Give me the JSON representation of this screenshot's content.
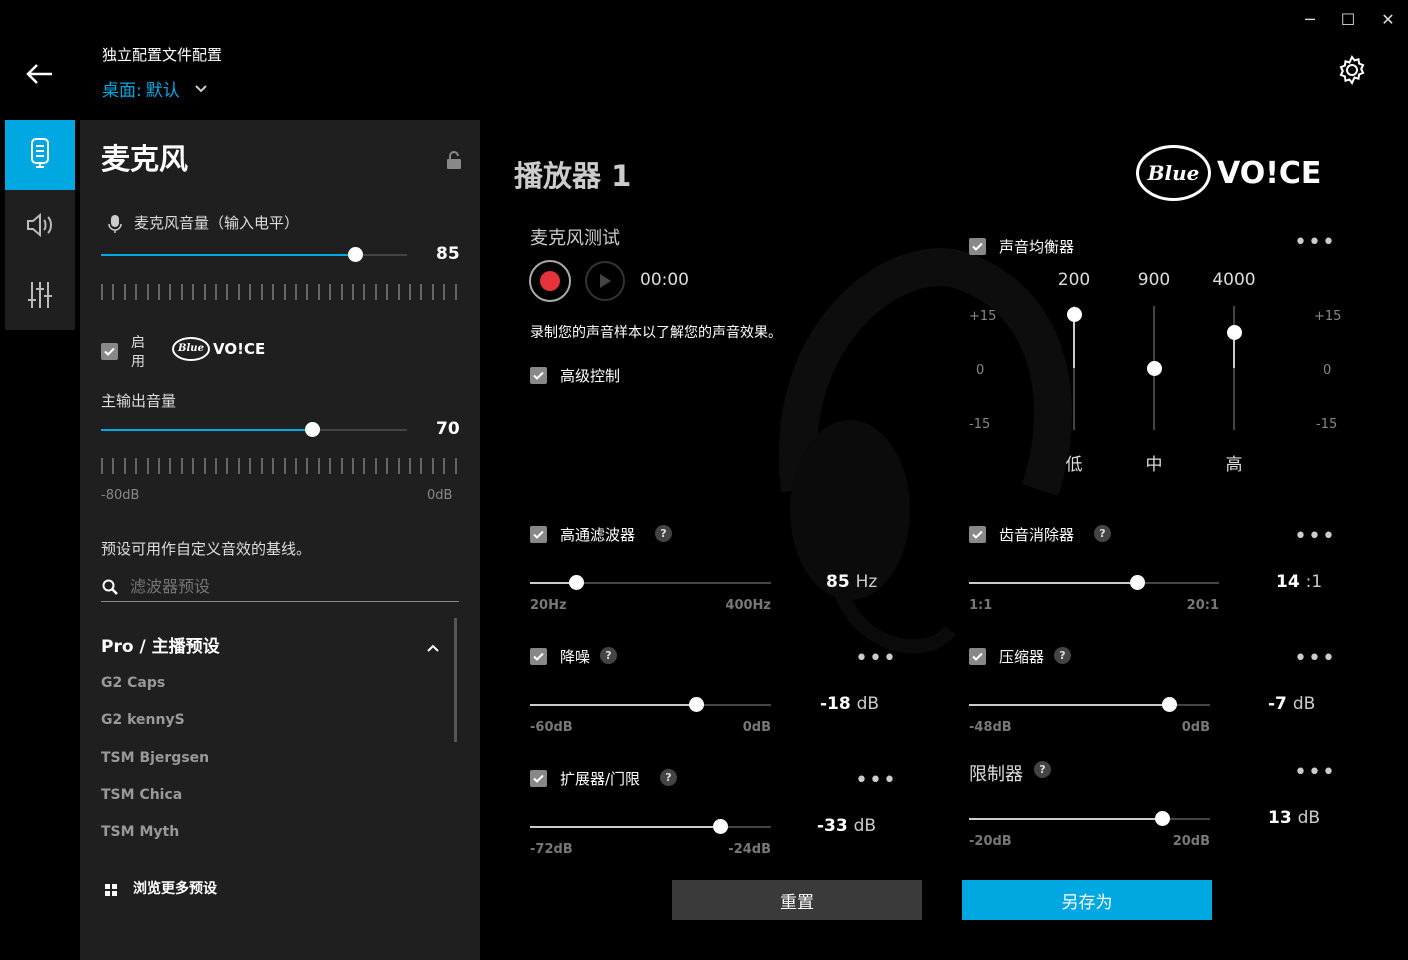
{
  "window": {
    "minimize": "─",
    "maximize": "☐",
    "close": "✕"
  },
  "header": {
    "subtitle": "独立配置文件配置",
    "profile_prefix": "桌面: ",
    "profile_name": "默认"
  },
  "left": {
    "title": "麦克风",
    "mic_volume_label": "麦克风音量（输入电平）",
    "mic_volume": 85,
    "mic_volume_display": "85",
    "enable_label_1": "启",
    "enable_label_2": "用",
    "output_label": "主输出音量",
    "output_volume": 70,
    "output_volume_display": "70",
    "output_min": "-80dB",
    "output_max": "0dB",
    "preset_desc": "预设可用作自定义音效的基线。",
    "search_placeholder": "滤波器预设",
    "preset_group": "Pro / 主播预设",
    "presets": [
      "G2 Caps",
      "G2 kennyS",
      "TSM Bjergsen",
      "TSM Chica",
      "TSM Myth"
    ],
    "browse_more": "浏览更多预设"
  },
  "main": {
    "title": "播放器 1",
    "mic_test": "麦克风测试",
    "time": "00:00",
    "record_hint": "录制您的声音样本以了解您的声音效果。",
    "advanced": "高级控制",
    "logo_blue": "Blue",
    "logo_voice": "VO!CE"
  },
  "eq": {
    "label": "声音均衡器",
    "freqs": [
      "200",
      "900",
      "4000"
    ],
    "bands": [
      "低",
      "中",
      "高"
    ],
    "gains": [
      15,
      0,
      10
    ],
    "scale_top": "+15",
    "scale_mid": "0",
    "scale_bot": "-15"
  },
  "hpf": {
    "label": "高通滤波器",
    "min": "20Hz",
    "max": "400Hz",
    "value": "85",
    "unit": "Hz",
    "pos": 0.19
  },
  "deesser": {
    "label": "齿音消除器",
    "min": "1:1",
    "max": "20:1",
    "value": "14",
    "unit": ":1",
    "pos": 0.67
  },
  "noise": {
    "label": "降噪",
    "min": "-60dB",
    "max": "0dB",
    "value": "-18",
    "unit": "dB",
    "pos": 0.69
  },
  "compressor": {
    "label": "压缩器",
    "min": "-48dB",
    "max": "0dB",
    "value": "-7",
    "unit": "dB",
    "pos": 0.83
  },
  "expander": {
    "label": "扩展器/门限",
    "min": "-72dB",
    "max": "-24dB",
    "value": "-33",
    "unit": "dB",
    "pos": 0.79
  },
  "limiter": {
    "label": "限制器",
    "min": "-20dB",
    "max": "20dB",
    "value": "13",
    "unit": "dB",
    "pos": 0.8
  },
  "buttons": {
    "reset": "重置",
    "save_as": "另存为"
  },
  "colors": {
    "accent": "#00a8e1",
    "record": "#e5323b"
  }
}
